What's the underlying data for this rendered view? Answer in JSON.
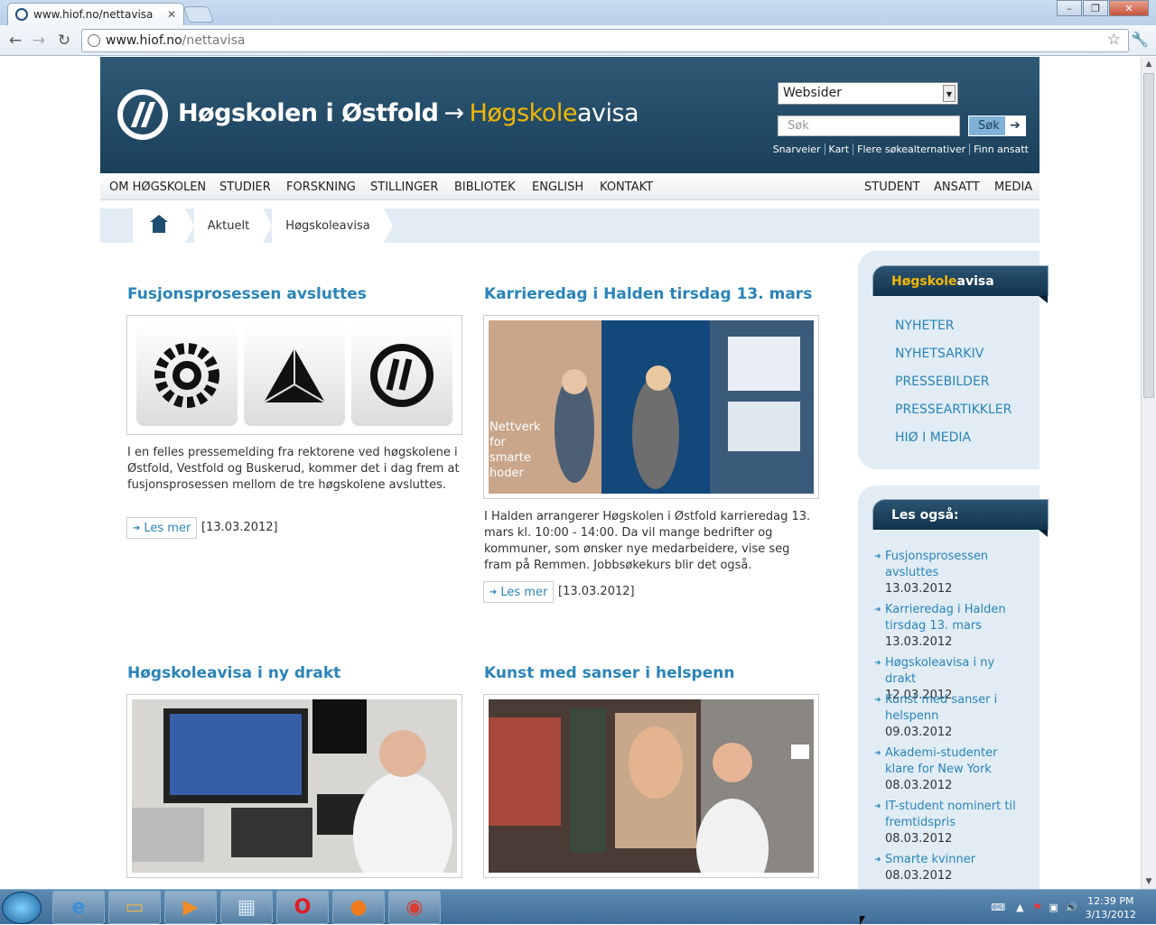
{
  "browser": {
    "tab_title": "www.hiof.no/nettavisa",
    "url_host": "www.hiof.no",
    "url_path": "/nettavisa"
  },
  "header": {
    "logo_text": "Høgskolen i Østfold",
    "logo_arrow": "→",
    "avisa_yellow": "Høgskole",
    "avisa_white": "avisa",
    "search_select": "Websider",
    "search_placeholder": "Søk",
    "search_button": "Søk",
    "links": [
      "Snarveier",
      "Kart",
      "Flere søkealternativer",
      "Finn ansatt"
    ]
  },
  "menu": {
    "left": [
      "OM HØGSKOLEN",
      "STUDIER",
      "FORSKNING",
      "STILLINGER",
      "BIBLIOTEK",
      "ENGLISH",
      "KONTAKT"
    ],
    "right": [
      "STUDENT",
      "ANSATT",
      "MEDIA"
    ]
  },
  "breadcrumb": [
    "Aktuelt",
    "Høgskoleavisa"
  ],
  "articles": [
    {
      "title": "Fusjonsprosessen avsluttes",
      "body": "I en felles pressemelding fra rektorene ved høgskolene i Østfold, Vestfold og Buskerud, kommer det i dag frem at fusjonsprosessen mellom de tre høgskolene avsluttes.",
      "more": "Les mer",
      "date": "[13.03.2012]"
    },
    {
      "title": "Karrieredag i Halden tirsdag 13. mars",
      "body": "I Halden arrangerer Høgskolen i Østfold karrieredag 13. mars kl. 10:00 - 14:00. Da vil mange bedrifter og kommuner, som ønsker nye medarbeidere, vise seg fram på Remmen. Jobbsøkekurs blir det også.",
      "more": "Les mer",
      "date": "[13.03.2012]",
      "photo_text": "Nettverk for smarte hoder"
    },
    {
      "title": "Høgskoleavisa i ny drakt"
    },
    {
      "title": "Kunst med sanser i helspenn"
    }
  ],
  "sidebar": {
    "box1_title_yellow": "Høgskole",
    "box1_title_white": "avisa",
    "links": [
      "NYHETER",
      "NYHETSARKIV",
      "PRESSEBILDER",
      "PRESSEARTIKKLER",
      "HIØ I MEDIA"
    ],
    "box2_title": "Les også:",
    "les_ogsa": [
      {
        "t": "Fusjonsprosessen avsluttes",
        "d": "13.03.2012"
      },
      {
        "t": "Karrieredag i Halden tirsdag 13. mars",
        "d": "13.03.2012"
      },
      {
        "t": "Høgskoleavisa i ny drakt",
        "d": "12.03.2012"
      },
      {
        "t": "Kunst med sanser i helspenn",
        "d": "09.03.2012"
      },
      {
        "t": "Akademi-studenter klare for New York",
        "d": "08.03.2012"
      },
      {
        "t": "IT-student nominert til fremtidspris",
        "d": "08.03.2012"
      },
      {
        "t": "Smarte kvinner",
        "d": "08.03.2012"
      }
    ]
  },
  "taskbar": {
    "time": "12:39 PM",
    "date": "3/13/2012"
  }
}
